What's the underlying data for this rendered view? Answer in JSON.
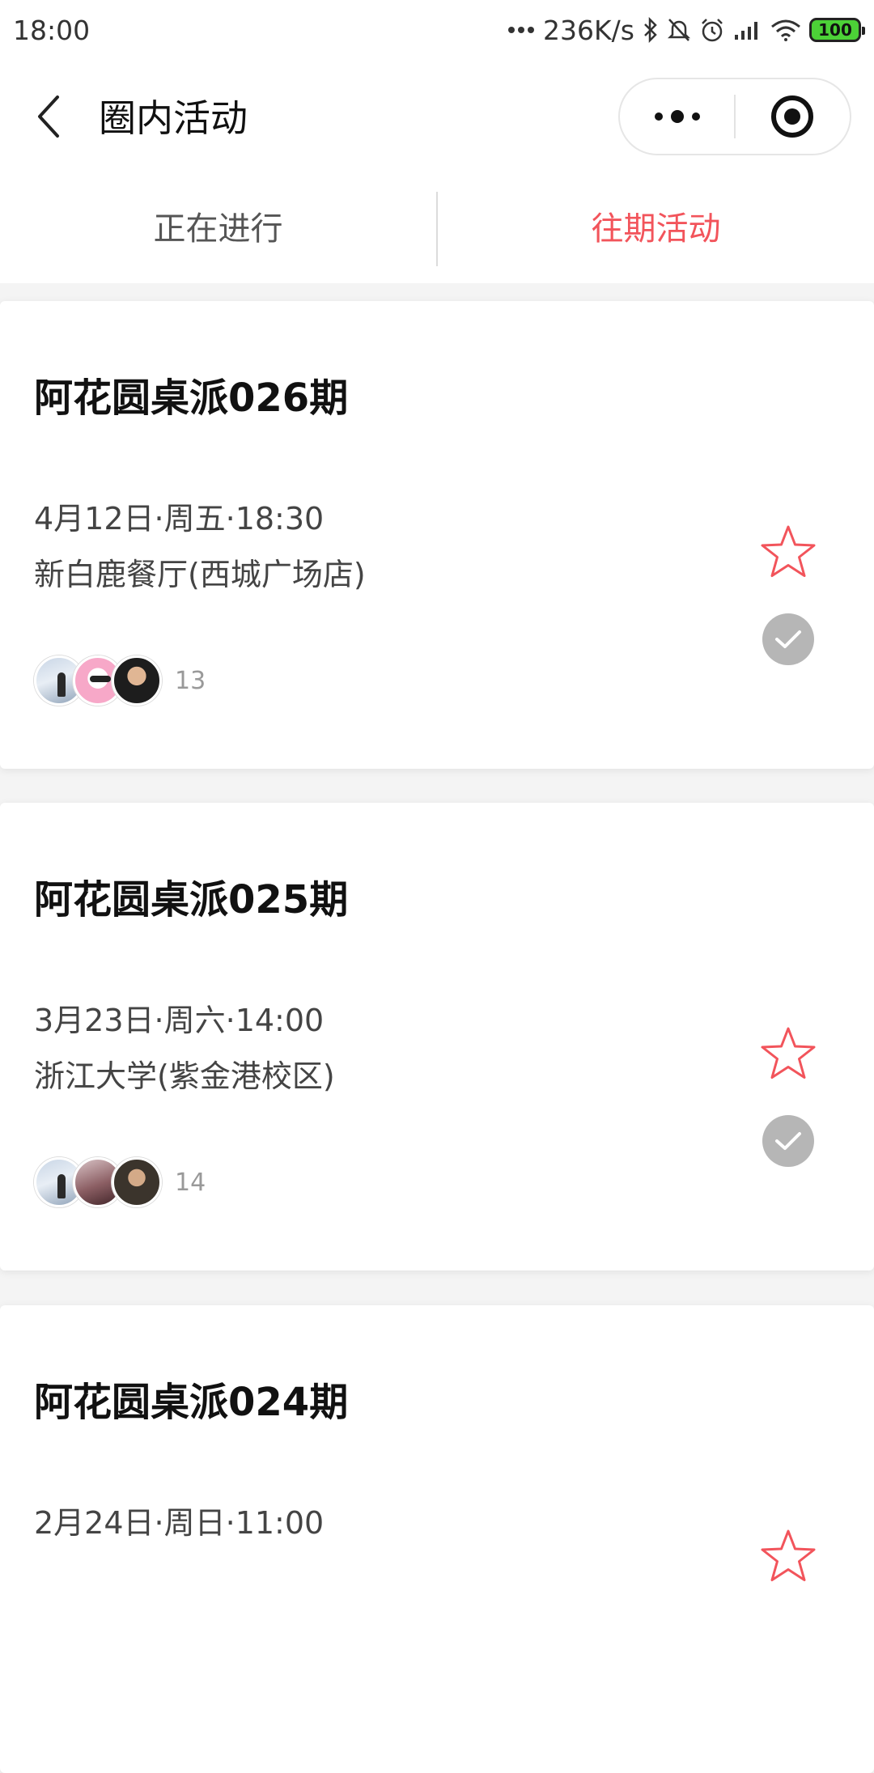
{
  "status_bar": {
    "time": "18:00",
    "network_speed": "236K/s",
    "battery_level": "100",
    "icons": [
      "more-dots-icon",
      "bluetooth-icon",
      "mute-bell-icon",
      "alarm-icon",
      "signal-icon",
      "wifi-icon",
      "battery-icon"
    ]
  },
  "nav": {
    "title": "圈内活动",
    "back_icon": "chevron-left-icon",
    "more_icon": "more-dots-icon",
    "close_icon": "target-circle-icon"
  },
  "tabs": [
    {
      "label": "正在进行",
      "active": false
    },
    {
      "label": "往期活动",
      "active": true
    }
  ],
  "colors": {
    "accent": "#f2545b",
    "check_bg": "#b6b6b6",
    "battery": "#4cd137"
  },
  "events": [
    {
      "title": "阿花圆桌派026期",
      "datetime": "4月12日·周五·18:30",
      "location": "新白鹿餐厅(西城广场店)",
      "participant_count": "13",
      "favorited": false,
      "checked": true
    },
    {
      "title": "阿花圆桌派025期",
      "datetime": "3月23日·周六·14:00",
      "location": "浙江大学(紫金港校区)",
      "participant_count": "14",
      "favorited": false,
      "checked": true
    },
    {
      "title": "阿花圆桌派024期",
      "datetime": "2月24日·周日·11:00",
      "location": "",
      "participant_count": "",
      "favorited": false,
      "checked": false
    }
  ]
}
